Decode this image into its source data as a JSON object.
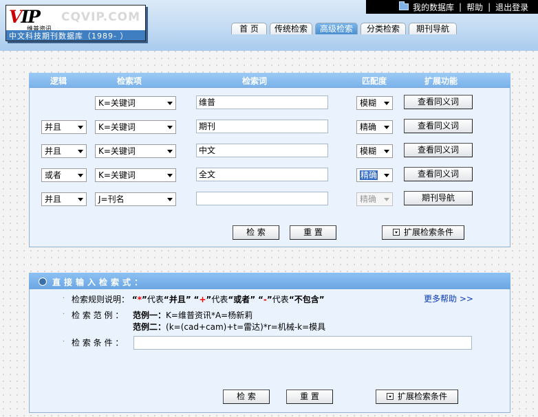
{
  "header": {
    "top_links": [
      "我的数据库",
      "帮助",
      "退出登录"
    ],
    "logo": {
      "mark": "VIP",
      "brand_cn": "维普资讯",
      "brand_url": "CQVIP.COM",
      "subtitle": "中文科技期刊数据库（1989- ）"
    },
    "tabs": [
      {
        "label": "首 页",
        "active": false
      },
      {
        "label": "传统检索",
        "active": false
      },
      {
        "label": "高级检索",
        "active": true
      },
      {
        "label": "分类检索",
        "active": false
      },
      {
        "label": "期刊导航",
        "active": false
      }
    ]
  },
  "advanced": {
    "columns": [
      "逻辑",
      "检索项",
      "检索词",
      "匹配度",
      "扩展功能"
    ],
    "rows": [
      {
        "logic": "",
        "field": "K=关键词",
        "term": "维普",
        "match": "模糊",
        "match_disabled": false,
        "action": "查看同义词"
      },
      {
        "logic": "并且",
        "field": "K=关键词",
        "term": "期刊",
        "match": "精确",
        "match_disabled": false,
        "action": "查看同义词"
      },
      {
        "logic": "并且",
        "field": "K=关键词",
        "term": "中文",
        "match": "模糊",
        "match_disabled": false,
        "action": "查看同义词"
      },
      {
        "logic": "或者",
        "field": "K=关键词",
        "term": "全文",
        "match": "精确",
        "match_disabled": false,
        "match_highlighted": true,
        "action": "查看同义词"
      },
      {
        "logic": "并且",
        "field": "J=刊名",
        "term": "",
        "match": "精确",
        "match_disabled": true,
        "action": "期刊导航"
      }
    ],
    "search_button": "检 索",
    "reset_button": "重 置",
    "expand_button": "扩展检索条件"
  },
  "direct": {
    "title": "直接输入检索式：",
    "rules_label": "检索规则说明：",
    "rules": {
      "q_open": "“",
      "q_close": "”",
      "op1": "*",
      "op1_meaning": "并且",
      "op2": "+",
      "op2_meaning": "或者",
      "op3": "-",
      "op3_meaning": "不包含",
      "stands_for": "代表"
    },
    "more_help": "更多帮助 >>",
    "examples_label": "检 索 范 例 ：",
    "example1_label": "范例一：",
    "example1_text": "K=维普资讯*A=杨新莉",
    "example2_label": "范例二：",
    "example2_text": "(k=(cad+cam)+t=雷达)*r=机械-k=模具",
    "condition_label": "检 索 条 件 ：",
    "condition_value": "",
    "search_button": "检 索",
    "reset_button": "重 置",
    "expand_button": "扩展检索条件"
  }
}
